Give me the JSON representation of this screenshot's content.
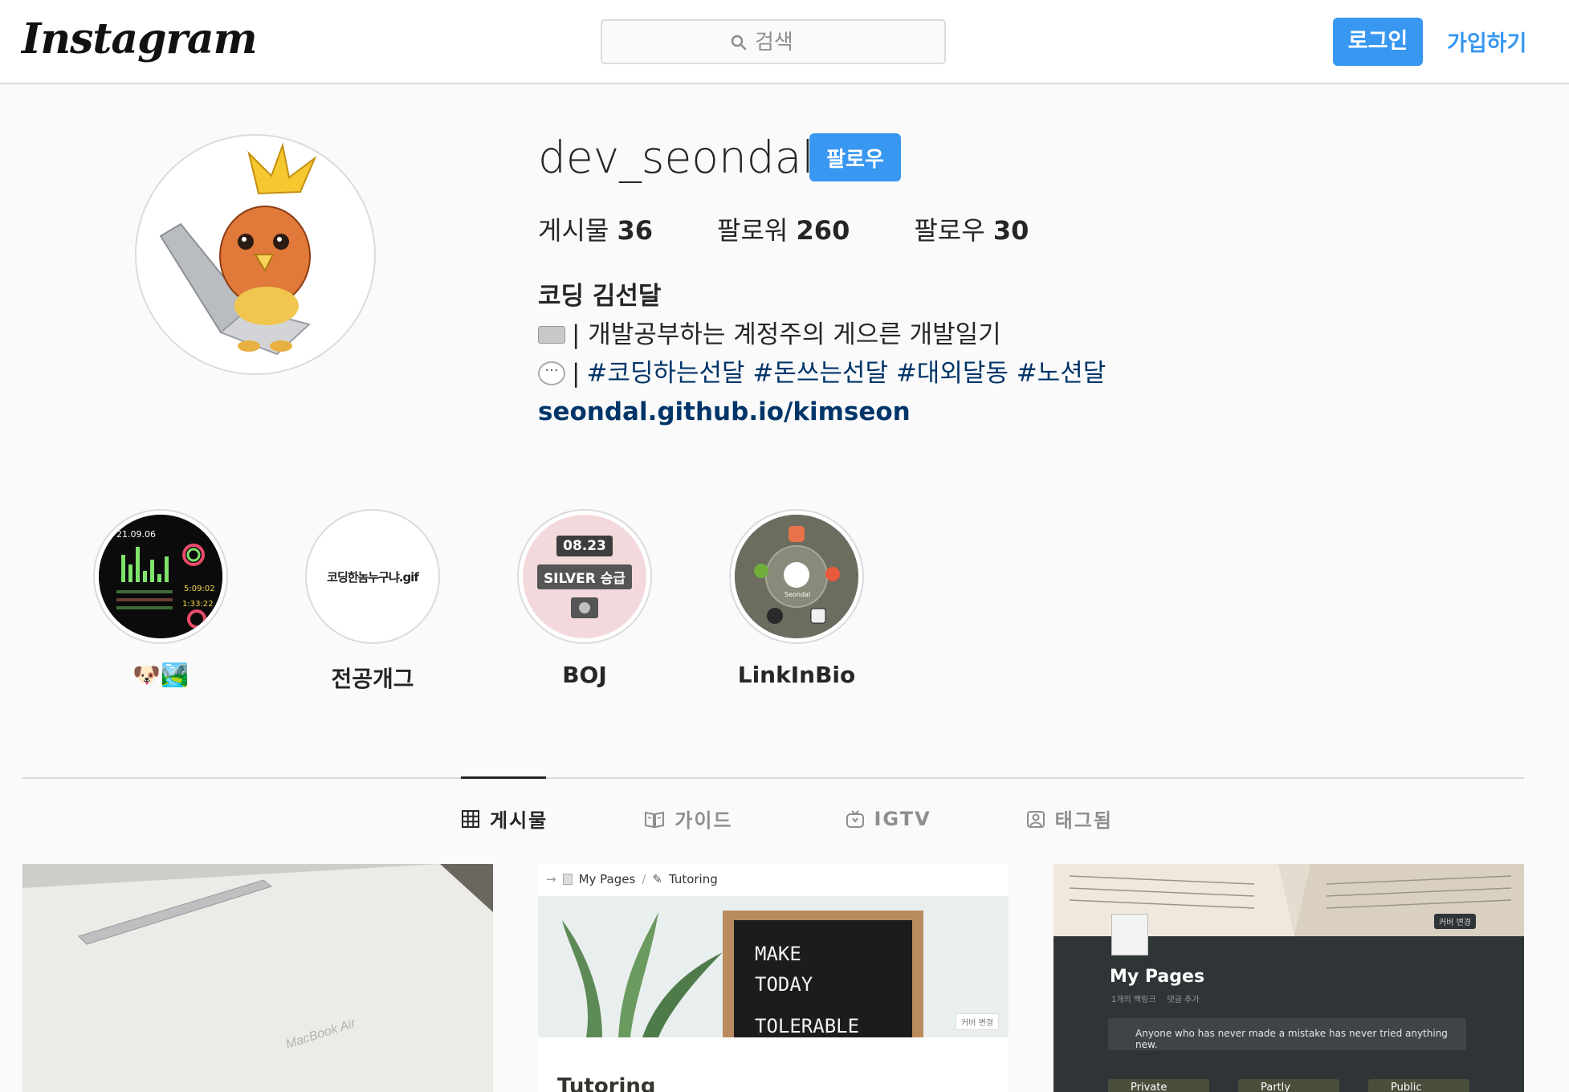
{
  "nav": {
    "logo": "Instagram",
    "search_placeholder": "검색",
    "login_label": "로그인",
    "signup_label": "가입하기"
  },
  "profile": {
    "username": "dev_seondal",
    "follow_label": "팔로우",
    "stats": {
      "posts_label": "게시물",
      "posts_count": "36",
      "followers_label": "팔로워",
      "followers_count": "260",
      "following_label": "팔로우",
      "following_count": "30"
    },
    "bio": {
      "name": "코딩 김선달",
      "line1": "| 개발공부하는 계정주의 게으른 개발일기",
      "line2_prefix": "|",
      "hashtags": "#코딩하는선달 #돈쓰는선달 #대외달동 #노션달",
      "link": "seondal.github.io/kimseon"
    }
  },
  "highlights": [
    {
      "label": "🐶🏞️",
      "image_text": "21.09.06",
      "watch_time": "5:09:02",
      "watch_sub": "1:33:22"
    },
    {
      "label": "전공개그",
      "image_text": "코딩한놈누구냐.gif"
    },
    {
      "label": "BOJ",
      "badge_top": "08.23",
      "badge_mid": "SILVER 승급"
    },
    {
      "label": "LinkInBio",
      "center_text": "Seondal"
    }
  ],
  "tabs": [
    {
      "label": "게시물",
      "icon": "grid-icon",
      "active": true
    },
    {
      "label": "가이드",
      "icon": "guide-icon",
      "active": false
    },
    {
      "label": "IGTV",
      "icon": "igtv-icon",
      "active": false
    },
    {
      "label": "태그됨",
      "icon": "tagged-icon",
      "active": false
    }
  ],
  "posts": [
    {
      "box_text": "MacBook Air"
    },
    {
      "crumb1": "My Pages",
      "crumb_sep": "/",
      "crumb2": "Tutoring",
      "board_line1": "MAKE",
      "board_line2": "TODAY",
      "board_line3": "TOLERABLE",
      "cover_label": "커버 변경",
      "title": "Tutoring"
    },
    {
      "title": "My Pages",
      "meta1": "1개의 백링크",
      "meta2": "댓글 추가",
      "quote": "Anyone who has never made a mistake has never tried anything new.",
      "cover_label": "커버 변경",
      "tags": [
        "Private",
        "Partly",
        "Public"
      ]
    }
  ],
  "colors": {
    "accent": "#3897f0",
    "link": "#003569",
    "border": "#dbdbdb"
  }
}
